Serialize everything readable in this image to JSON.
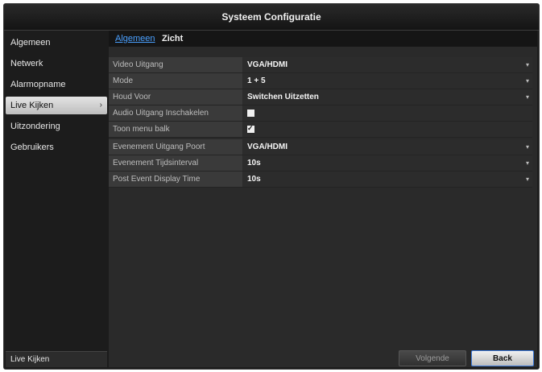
{
  "window": {
    "title": "Systeem Configuratie"
  },
  "sidebar": {
    "items": [
      {
        "label": "Algemeen"
      },
      {
        "label": "Netwerk"
      },
      {
        "label": "Alarmopname"
      },
      {
        "label": "Live Kijken",
        "active": true
      },
      {
        "label": "Uitzondering"
      },
      {
        "label": "Gebruikers"
      }
    ],
    "footer": "Live Kijken"
  },
  "tabs": [
    {
      "label": "Algemeen",
      "active": true
    },
    {
      "label": "Zicht",
      "active": false
    }
  ],
  "settings": {
    "video_output": {
      "label": "Video Uitgang",
      "value": "VGA/HDMI"
    },
    "mode": {
      "label": "Mode",
      "value": "1 + 5"
    },
    "hold_for": {
      "label": "Houd Voor",
      "value": "Switchen Uitzetten"
    },
    "audio_output": {
      "label": "Audio Uitgang Inschakelen",
      "checked": false
    },
    "show_menu_bar": {
      "label": "Toon menu balk",
      "checked": true
    },
    "event_output_port": {
      "label": "Evenement Uitgang Poort",
      "value": "VGA/HDMI"
    },
    "event_interval": {
      "label": "Evenement Tijdsinterval",
      "value": "10s"
    },
    "post_event_display_time": {
      "label": "Post Event Display Time",
      "value": "10s"
    }
  },
  "buttons": {
    "next": "Volgende",
    "back": "Back"
  },
  "colors": {
    "accent": "#4aa0ff",
    "background": "#1c1c1c",
    "panel": "#2a2a2a"
  }
}
